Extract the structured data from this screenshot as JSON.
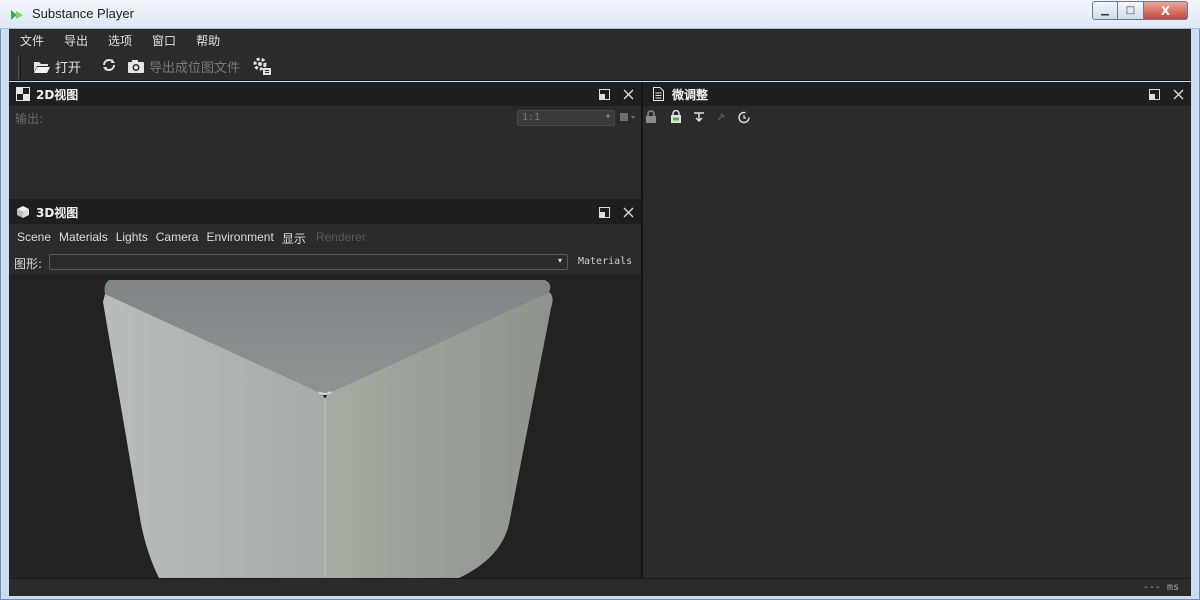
{
  "window": {
    "title": "Substance Player",
    "min_glyph": "▁",
    "max_glyph": "□",
    "close_glyph": "X"
  },
  "menu": [
    "文件",
    "导出",
    "选项",
    "窗口",
    "帮助"
  ],
  "toolbar": {
    "open_label": "打开",
    "export_label": "导出成位图文件"
  },
  "panel_2d": {
    "title": "2D视图",
    "output_label": "输出:",
    "zoom_value": "1:1"
  },
  "panel_3d": {
    "title": "3D视图",
    "menu": [
      "Scene",
      "Materials",
      "Lights",
      "Camera",
      "Environment",
      "显示",
      "Renderer"
    ],
    "shape_label": "图形:",
    "shape_value": "",
    "materials_btn": "Materials"
  },
  "panel_tweaks": {
    "title": "微调整"
  },
  "status": {
    "timing": "--- ms"
  },
  "colors": {
    "bg": "#2b2b2b",
    "dark": "#1f1f1f",
    "accent_green": "#4caf50",
    "cube": "#9ea39e"
  }
}
